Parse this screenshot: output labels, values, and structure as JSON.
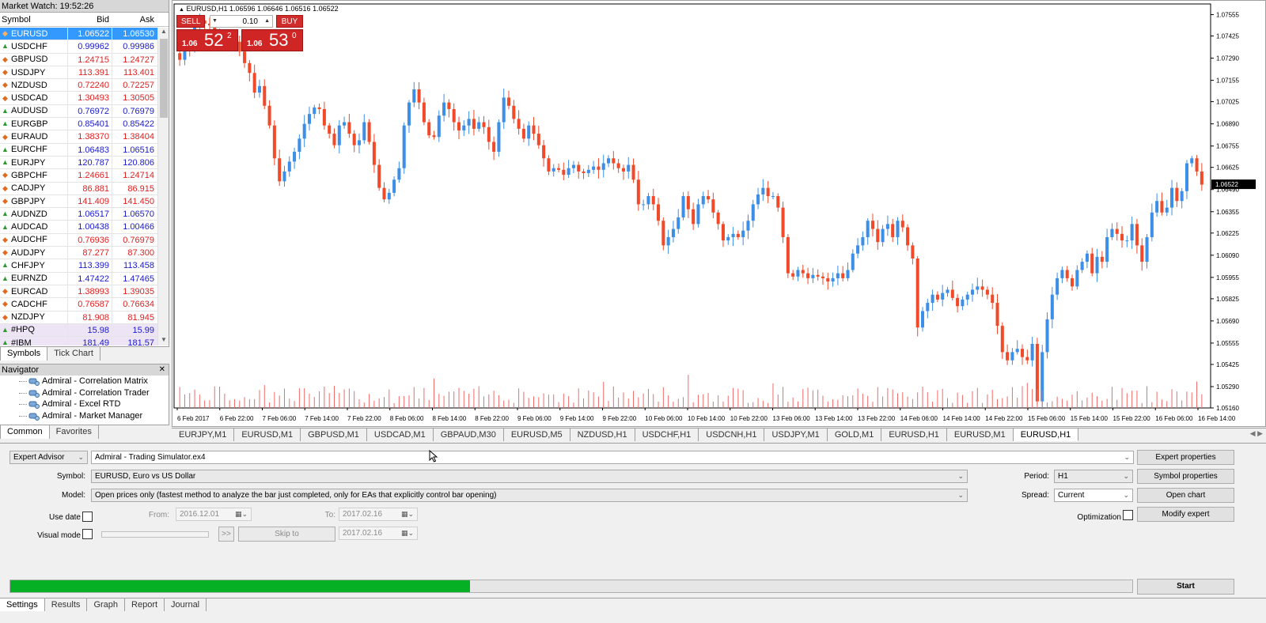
{
  "market_watch": {
    "title": "Market Watch: 19:52:26",
    "headers": {
      "symbol": "Symbol",
      "bid": "Bid",
      "ask": "Ask"
    },
    "rows": [
      {
        "symbol": "EURUSD",
        "bid": "1.06522",
        "ask": "1.06530",
        "dir": "dn",
        "color": "#ffffff",
        "selected": true
      },
      {
        "symbol": "USDCHF",
        "bid": "0.99962",
        "ask": "0.99986",
        "dir": "up",
        "color": "#1a1acc"
      },
      {
        "symbol": "GBPUSD",
        "bid": "1.24715",
        "ask": "1.24727",
        "dir": "dn",
        "color": "#e02020"
      },
      {
        "symbol": "USDJPY",
        "bid": "113.391",
        "ask": "113.401",
        "dir": "dn",
        "color": "#e02020"
      },
      {
        "symbol": "NZDUSD",
        "bid": "0.72240",
        "ask": "0.72257",
        "dir": "dn",
        "color": "#e02020"
      },
      {
        "symbol": "USDCAD",
        "bid": "1.30493",
        "ask": "1.30505",
        "dir": "dn",
        "color": "#e02020"
      },
      {
        "symbol": "AUDUSD",
        "bid": "0.76972",
        "ask": "0.76979",
        "dir": "up",
        "color": "#1a1acc"
      },
      {
        "symbol": "EURGBP",
        "bid": "0.85401",
        "ask": "0.85422",
        "dir": "up",
        "color": "#1a1acc"
      },
      {
        "symbol": "EURAUD",
        "bid": "1.38370",
        "ask": "1.38404",
        "dir": "dn",
        "color": "#e02020"
      },
      {
        "symbol": "EURCHF",
        "bid": "1.06483",
        "ask": "1.06516",
        "dir": "up",
        "color": "#1a1acc"
      },
      {
        "symbol": "EURJPY",
        "bid": "120.787",
        "ask": "120.806",
        "dir": "up",
        "color": "#1a1acc"
      },
      {
        "symbol": "GBPCHF",
        "bid": "1.24661",
        "ask": "1.24714",
        "dir": "dn",
        "color": "#e02020"
      },
      {
        "symbol": "CADJPY",
        "bid": "86.881",
        "ask": "86.915",
        "dir": "dn",
        "color": "#e02020"
      },
      {
        "symbol": "GBPJPY",
        "bid": "141.409",
        "ask": "141.450",
        "dir": "dn",
        "color": "#e02020"
      },
      {
        "symbol": "AUDNZD",
        "bid": "1.06517",
        "ask": "1.06570",
        "dir": "up",
        "color": "#1a1acc"
      },
      {
        "symbol": "AUDCAD",
        "bid": "1.00438",
        "ask": "1.00466",
        "dir": "up",
        "color": "#1a1acc"
      },
      {
        "symbol": "AUDCHF",
        "bid": "0.76936",
        "ask": "0.76979",
        "dir": "dn",
        "color": "#e02020"
      },
      {
        "symbol": "AUDJPY",
        "bid": "87.277",
        "ask": "87.300",
        "dir": "dn",
        "color": "#e02020"
      },
      {
        "symbol": "CHFJPY",
        "bid": "113.399",
        "ask": "113.458",
        "dir": "up",
        "color": "#1a1acc"
      },
      {
        "symbol": "EURNZD",
        "bid": "1.47422",
        "ask": "1.47465",
        "dir": "up",
        "color": "#1a1acc"
      },
      {
        "symbol": "EURCAD",
        "bid": "1.38993",
        "ask": "1.39035",
        "dir": "dn",
        "color": "#e02020"
      },
      {
        "symbol": "CADCHF",
        "bid": "0.76587",
        "ask": "0.76634",
        "dir": "dn",
        "color": "#e02020"
      },
      {
        "symbol": "NZDJPY",
        "bid": "81.908",
        "ask": "81.945",
        "dir": "dn",
        "color": "#e02020"
      },
      {
        "symbol": "#HPQ",
        "bid": "15.98",
        "ask": "15.99",
        "dir": "up",
        "color": "#1a1acc",
        "stock": true
      },
      {
        "symbol": "#IBM",
        "bid": "181.49",
        "ask": "181.57",
        "dir": "up",
        "color": "#1a1acc",
        "stock": true
      }
    ],
    "tabs": [
      "Symbols",
      "Tick Chart"
    ]
  },
  "navigator": {
    "title": "Navigator",
    "items": [
      "Admiral - Correlation Matrix",
      "Admiral - Correlation Trader",
      "Admiral - Excel RTD",
      "Admiral - Market Manager"
    ],
    "tabs": [
      "Common",
      "Favorites"
    ]
  },
  "chart": {
    "title": "EURUSD,H1  1.06596 1.06646 1.06516 1.06522",
    "current_price_label": "1.06522",
    "trade_panel": {
      "sell_label": "SELL",
      "buy_label": "BUY",
      "lot": "0.10",
      "sell_prefix": "1.06",
      "sell_big": "52",
      "sell_sup": "2",
      "buy_prefix": "1.06",
      "buy_big": "53",
      "buy_sup": "0"
    },
    "colors": {
      "bull": "#3c8ee6",
      "bear": "#f04a2a",
      "volume": "#f06a6a",
      "price_tag_bg": "#000000"
    },
    "tabs": [
      "EURJPY,M1",
      "EURUSD,M1",
      "GBPUSD,M1",
      "USDCAD,M1",
      "GBPAUD,M30",
      "EURUSD,M5",
      "NZDUSD,H1",
      "USDCHF,H1",
      "USDCNH,H1",
      "USDJPY,M1",
      "GOLD,M1",
      "EURUSD,H1",
      "EURUSD,M1",
      "EURUSD,H1"
    ],
    "active_tab_index": 13
  },
  "chart_data": {
    "type": "candlestick",
    "symbol": "EURUSD",
    "timeframe": "H1",
    "y_ticks": [
      "1.07555",
      "1.07425",
      "1.07290",
      "1.07155",
      "1.07025",
      "1.06890",
      "1.06755",
      "1.06625",
      "1.06490",
      "1.06355",
      "1.06225",
      "1.06090",
      "1.05955",
      "1.05825",
      "1.05690",
      "1.05555",
      "1.05425",
      "1.05290",
      "1.05160"
    ],
    "ylim": [
      1.0516,
      1.0762
    ],
    "x_ticks": [
      "6 Feb 2017",
      "6 Feb 22:00",
      "7 Feb 06:00",
      "7 Feb 14:00",
      "7 Feb 22:00",
      "8 Feb 06:00",
      "8 Feb 14:00",
      "8 Feb 22:00",
      "9 Feb 06:00",
      "9 Feb 14:00",
      "9 Feb 22:00",
      "10 Feb 06:00",
      "10 Feb 14:00",
      "10 Feb 22:00",
      "13 Feb 06:00",
      "13 Feb 14:00",
      "13 Feb 22:00",
      "14 Feb 06:00",
      "14 Feb 14:00",
      "14 Feb 22:00",
      "15 Feb 06:00",
      "15 Feb 14:00",
      "15 Feb 22:00",
      "16 Feb 06:00",
      "16 Feb 14:00"
    ],
    "closes": [
      1.0728,
      1.0742,
      1.0735,
      1.0748,
      1.0752,
      1.075,
      1.0749,
      1.0745,
      1.0742,
      1.0741,
      1.074,
      1.0739,
      1.0733,
      1.0726,
      1.072,
      1.0708,
      1.0712,
      1.07,
      1.0688,
      1.0668,
      1.0654,
      1.066,
      1.0666,
      1.0672,
      1.068,
      1.0689,
      1.0695,
      1.0699,
      1.0698,
      1.0688,
      1.0683,
      1.0676,
      1.0688,
      1.069,
      1.0683,
      1.0676,
      1.0679,
      1.069,
      1.0678,
      1.0664,
      1.065,
      1.0643,
      1.0647,
      1.0655,
      1.0662,
      1.0688,
      1.0702,
      1.071,
      1.0702,
      1.069,
      1.0682,
      1.0681,
      1.0694,
      1.0702,
      1.0698,
      1.069,
      1.0685,
      1.0688,
      1.0692,
      1.0686,
      1.069,
      1.0687,
      1.0678,
      1.0672,
      1.069,
      1.0705,
      1.07,
      1.0692,
      1.0686,
      1.068,
      1.0688,
      1.0683,
      1.0676,
      1.0668,
      1.066,
      1.0662,
      1.0661,
      1.0658,
      1.0662,
      1.0664,
      1.066,
      1.0659,
      1.0661,
      1.0663,
      1.0661,
      1.0665,
      1.0668,
      1.0665,
      1.0662,
      1.066,
      1.0664,
      1.0655,
      1.064,
      1.064,
      1.0645,
      1.064,
      1.063,
      1.0615,
      1.062,
      1.0625,
      1.0632,
      1.0645,
      1.0637,
      1.0628,
      1.064,
      1.0645,
      1.0643,
      1.0635,
      1.0628,
      1.0618,
      1.062,
      1.0622,
      1.062,
      1.0624,
      1.063,
      1.064,
      1.0646,
      1.065,
      1.0645,
      1.0645,
      1.0638,
      1.062,
      1.0598,
      1.0596,
      1.06,
      1.0598,
      1.0595,
      1.0597,
      1.0596,
      1.0595,
      1.0593,
      1.0595,
      1.0598,
      1.0595,
      1.06,
      1.061,
      1.0615,
      1.062,
      1.063,
      1.0625,
      1.0617,
      1.0625,
      1.0628,
      1.062,
      1.063,
      1.0626,
      1.0615,
      1.0607,
      1.0565,
      1.0575,
      1.058,
      1.0585,
      1.0582,
      1.0586,
      1.0588,
      1.0583,
      1.0578,
      1.0582,
      1.0585,
      1.0588,
      1.059,
      1.0588,
      1.0585,
      1.058,
      1.0566,
      1.055,
      1.0545,
      1.055,
      1.0552,
      1.0547,
      1.0545,
      1.0555,
      1.052,
      1.055,
      1.057,
      1.0585,
      1.0595,
      1.06,
      1.0595,
      1.059,
      1.06,
      1.0605,
      1.061,
      1.0598,
      1.0608,
      1.0605,
      1.062,
      1.0625,
      1.0622,
      1.0618,
      1.0618,
      1.0628,
      1.0615,
      1.0605,
      1.062,
      1.0635,
      1.0642,
      1.0635,
      1.0638,
      1.065,
      1.0642,
      1.0648,
      1.0665,
      1.0668,
      1.066,
      1.0652
    ],
    "grid": false
  },
  "tester": {
    "type_select": "Expert Advisor",
    "expert_file": "Admiral - Trading Simulator.ex4",
    "symbol_label": "Symbol:",
    "symbol_value": "EURUSD, Euro vs US Dollar",
    "model_label": "Model:",
    "model_value": "Open prices only (fastest method to analyze the bar just completed, only for EAs that explicitly control bar opening)",
    "use_date_label": "Use date",
    "from_label": "From:",
    "from_value": "2016.12.01",
    "to_label": "To:",
    "to_value": "2017.02.16",
    "visual_mode_label": "Visual mode",
    "skip_btn": ">>",
    "skip_to_label": "Skip to",
    "skip_to_value": "2017.02.16",
    "period_label": "Period:",
    "period_value": "H1",
    "spread_label": "Spread:",
    "spread_value": "Current",
    "optimization_label": "Optimization",
    "buttons": {
      "expert_properties": "Expert properties",
      "symbol_properties": "Symbol properties",
      "open_chart": "Open chart",
      "modify_expert": "Modify expert",
      "start": "Start"
    },
    "progress": 0.41,
    "progress_color": "#06b025",
    "tabs": [
      "Settings",
      "Results",
      "Graph",
      "Report",
      "Journal"
    ]
  }
}
